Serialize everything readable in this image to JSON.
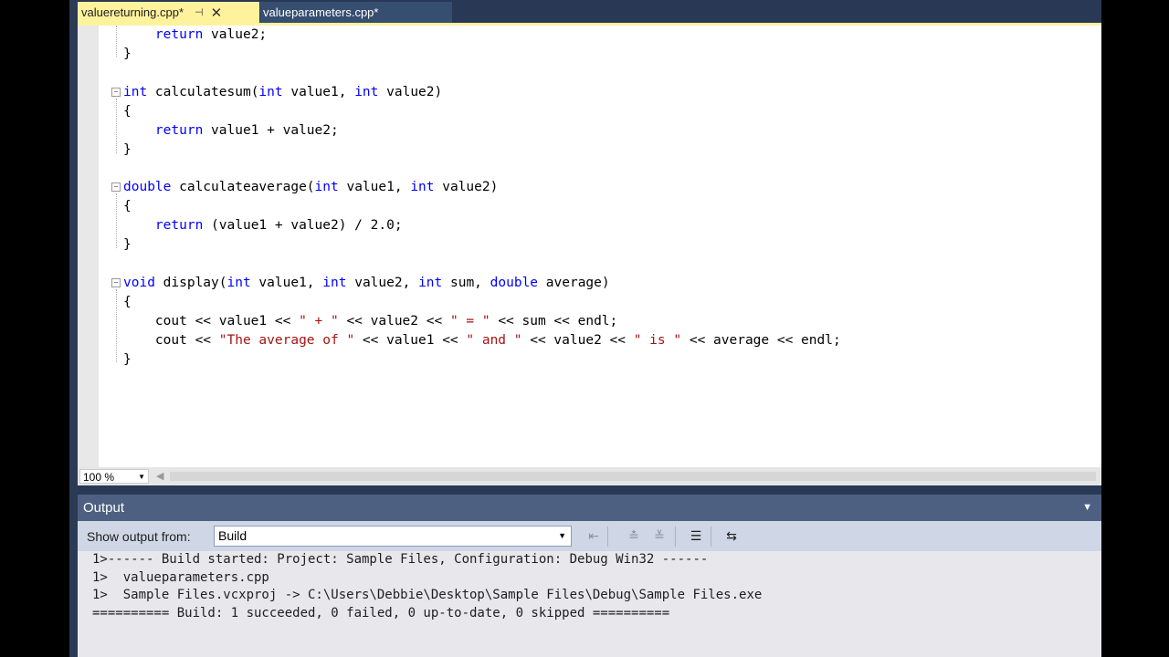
{
  "tabs": {
    "active": {
      "label": "valuereturning.cpp*",
      "pin": "⊣",
      "close": "✕"
    },
    "inactive": {
      "label": "valueparameters.cpp*"
    }
  },
  "zoom": {
    "value": "100 %",
    "arrow": "▼"
  },
  "output": {
    "title": "Output",
    "menu_caret": "▼",
    "show_label": "Show output from:",
    "source": "Build",
    "source_arrow": "▼",
    "lines": [
      "1>------ Build started: Project: Sample Files, Configuration: Debug Win32 ------",
      "1>  valueparameters.cpp",
      "1>  Sample Files.vcxproj -> C:\\Users\\Debbie\\Desktop\\Sample Files\\Debug\\Sample Files.exe",
      "========== Build: 1 succeeded, 0 failed, 0 up-to-date, 0 skipped =========="
    ],
    "toolbar_icons": [
      "goto-source-icon",
      "previous-message-icon",
      "next-message-icon",
      "clear-all-icon",
      "toggle-word-wrap-icon"
    ]
  },
  "colors": {
    "keyword": "#0000ff",
    "string": "#a31515",
    "active_tab": "#fff29d",
    "chrome": "#293955"
  }
}
